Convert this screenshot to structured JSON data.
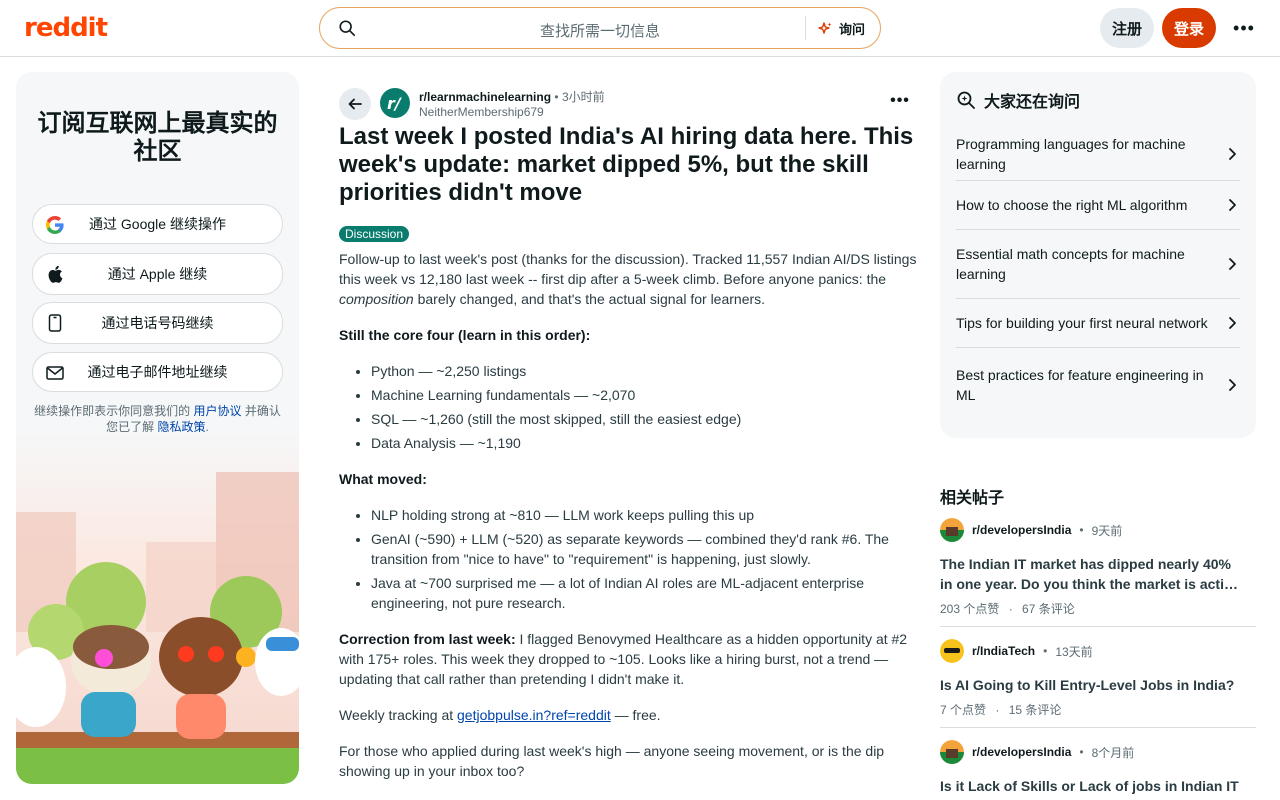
{
  "header": {
    "logo": "reddit",
    "search_placeholder": "查找所需一切信息",
    "ask_label": "询问",
    "signup_label": "注册",
    "login_label": "登录",
    "more_label": "•••"
  },
  "left": {
    "title": "订阅互联网上最真实的社区",
    "buttons": [
      {
        "label": "通过 Google 继续操作",
        "icon": "google-icon"
      },
      {
        "label": "通过 Apple 继续",
        "icon": "apple-icon"
      },
      {
        "label": "通过电话号码继续",
        "icon": "phone-icon"
      },
      {
        "label": "通过电子邮件地址继续",
        "icon": "mail-icon"
      }
    ],
    "terms_prefix": "继续操作即表示你同意我们的 ",
    "terms_link": "用户协议",
    "terms_middle": " 并确认您已了解 ",
    "privacy_link": "隐私政策",
    "terms_suffix": "."
  },
  "post": {
    "subreddit": "r/learnmachinelearning",
    "sep": "•",
    "time": "3小时前",
    "author": "NeitherMembership679",
    "more_label": "•••",
    "title": "Last week I posted India's AI hiring data here. This week's update: market dipped 5%, but the skill priorities didn't move",
    "flair": "Discussion",
    "p1_pre": "Follow-up to last week's post (thanks for the discussion). Tracked 11,557 Indian AI/DS listings this week vs 12,180 last week -- first dip after a 5-week climb. Before anyone panics: the ",
    "p1_em": "composition",
    "p1_post": " barely changed, and that's the actual signal for learners.",
    "h1": "Still the core four (learn in this order):",
    "list1": [
      "Python — ~2,250 listings",
      "Machine Learning fundamentals — ~2,070",
      "SQL — ~1,260 (still the most skipped, still the easiest edge)",
      "Data Analysis — ~1,190"
    ],
    "h2": "What moved:",
    "list2": [
      "NLP holding strong at ~810 — LLM work keeps pulling this up",
      "GenAI (~590) + LLM (~520) as separate keywords — combined they'd rank #6. The transition from \"nice to have\" to \"requirement\" is happening, just slowly.",
      "Java at ~700 surprised me — a lot of Indian AI roles are ML-adjacent enterprise engineering, not pure research."
    ],
    "correction_label": "Correction from last week:",
    "correction_text": " I flagged Benovymed Healthcare as a hidden opportunity at #2 with 175+ roles. This week they dropped to ~105. Looks like a hiring burst, not a trend — updating that call rather than pretending I didn't make it.",
    "weekly_pre": "Weekly tracking at ",
    "weekly_link": "getjobpulse.in?ref=reddit",
    "weekly_post": " — free.",
    "closing": "For those who applied during last week's high — anyone seeing movement, or is the dip showing up in your inbox too?"
  },
  "ask": {
    "title": "大家还在询问",
    "items": [
      "Programming languages for machine learning",
      "How to choose the right ML algorithm",
      "Essential math concepts for machine learning",
      "Tips for building your first neural network",
      "Best practices for feature engineering in ML"
    ]
  },
  "related": {
    "title": "相关帖子",
    "posts": [
      {
        "sub": "r/developersIndia",
        "time": "9天前",
        "title": "The Indian IT market has dipped nearly 40% in one year. Do you think the market is acti…",
        "upvotes": "203 个点赞",
        "comments": "67 条评论"
      },
      {
        "sub": "r/IndiaTech",
        "time": "13天前",
        "title": "Is AI Going to Kill Entry-Level Jobs in India?",
        "upvotes": "7 个点赞",
        "comments": "15 条评论"
      },
      {
        "sub": "r/developersIndia",
        "time": "8个月前",
        "title": "Is it Lack of Skills or Lack of jobs in Indian IT market ?",
        "upvotes": "",
        "comments": ""
      }
    ],
    "sep": "•",
    "dot": "·"
  }
}
